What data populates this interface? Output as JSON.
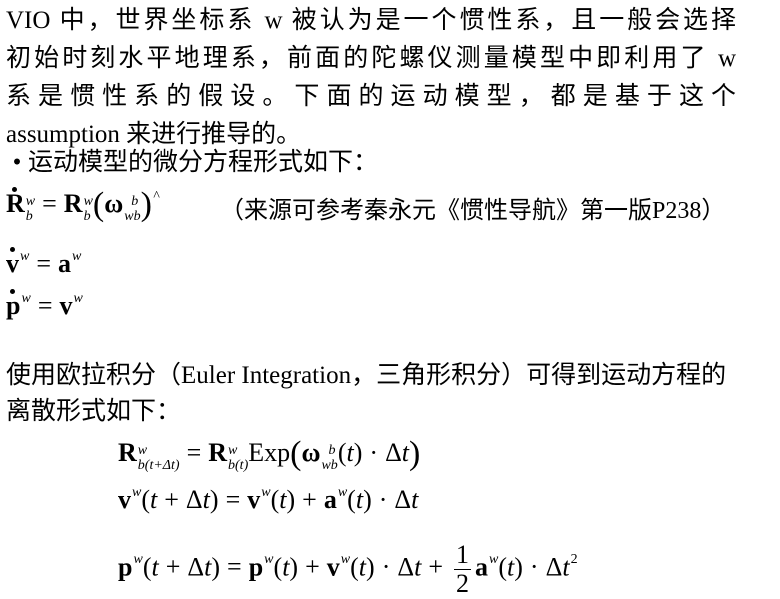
{
  "intro": {
    "lines": [
      "VIO 中，世界坐标系 w 被认为是一个惯性系，且一般会选择",
      "初始时刻水平地理系，前面的陀螺仪测量模型中即利用了 w",
      "系是惯性系的假设。下面的运动模型，都是基于这个"
    ],
    "last_line": "assumption 来进行推导的。"
  },
  "bullet": {
    "symbol": "•",
    "text": "运动模型的微分方程形式如下："
  },
  "continuous": {
    "source_note": "（来源可参考秦永元《惯性导航》第一版P238）"
  },
  "euler": {
    "text": "使用欧拉积分（Euler Integration，三角形积分）可得到运动方程的离散形式如下："
  }
}
